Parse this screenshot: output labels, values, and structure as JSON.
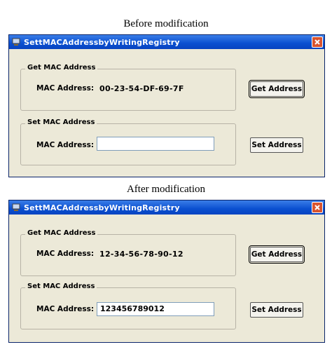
{
  "captions": {
    "before": "Before modification",
    "after": "After modification"
  },
  "windows": [
    {
      "title": "SettMACAddressbyWritingRegistry",
      "get_group": {
        "legend": "Get MAC Address",
        "label": "MAC Address:",
        "value": "00-23-54-DF-69-7F",
        "button": "Get Address"
      },
      "set_group": {
        "legend": "Set MAC Address",
        "label": "MAC Address:",
        "input_value": "",
        "button": "Set Address"
      }
    },
    {
      "title": "SettMACAddressbyWritingRegistry",
      "get_group": {
        "legend": "Get MAC Address",
        "label": "MAC Address:",
        "value": "12-34-56-78-90-12",
        "button": "Get Address"
      },
      "set_group": {
        "legend": "Set MAC Address",
        "label": "MAC Address:",
        "input_value": "123456789012",
        "button": "Set Address"
      }
    }
  ],
  "icons": {
    "app": "computer-icon",
    "close": "close-icon"
  },
  "colors": {
    "titlebar": "#0a4fd0",
    "close_button": "#d9542f",
    "window_bg": "#ece9d8"
  }
}
